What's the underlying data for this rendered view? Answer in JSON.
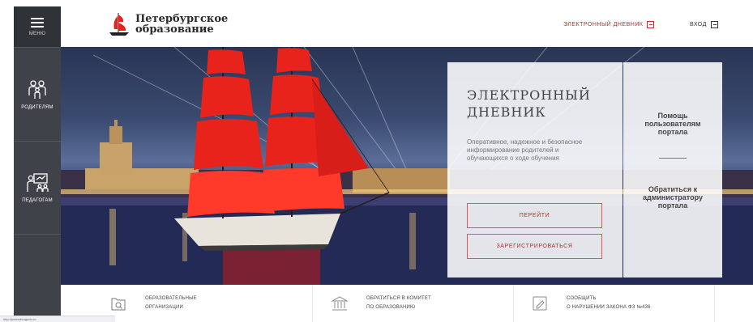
{
  "sidebar": {
    "menu_label": "МЕНЮ",
    "items": [
      {
        "label": "РОДИТЕЛЯМ",
        "icon": "family-icon"
      },
      {
        "label": "ПЕДАГОГАМ",
        "icon": "teacher-board-icon"
      }
    ]
  },
  "header": {
    "logo_line1": "Петербургское",
    "logo_line2": "образование",
    "diary_link": "ЭЛЕКТРОННЫЙ ДНЕВНИК",
    "login_link": "ВХОД"
  },
  "hero": {
    "title_line1": "ЭЛЕКТРОННЫЙ",
    "title_line2": "ДНЕВНИК",
    "description": "Оперативное, надежное и безопасное информирование родителей и обучающихся о ходе обучения",
    "go_button": "ПЕРЕЙТИ",
    "register_button": "ЗАРЕГИСТРИРОВАТЬСЯ"
  },
  "side_panel": {
    "help_line1": "Помощь",
    "help_line2": "пользователям",
    "help_line3": "портала",
    "admin_line1": "Обратиться к",
    "admin_line2": "администратору",
    "admin_line3": "портала"
  },
  "bottom_links": [
    {
      "line1": "ОБРАЗОВАТЕЛЬНЫЕ",
      "line2": "ОРГАНИЗАЦИИ",
      "icon": "search-folder-icon"
    },
    {
      "line1": "ОБРАТИТЬСЯ В КОМИТЕТ",
      "line2": "ПО ОБРАЗОВАНИЮ",
      "icon": "government-building-icon"
    },
    {
      "line1": "СООБЩИТЬ",
      "line2": "О НАРУШЕНИИ ЗАКОНА ФЗ №436",
      "icon": "pencil-note-icon"
    }
  ],
  "status_url": "http://petersburgedu.ru",
  "colors": {
    "accent": "#c62828",
    "sidebar": "#3f4248",
    "sails": "#e8231c"
  }
}
